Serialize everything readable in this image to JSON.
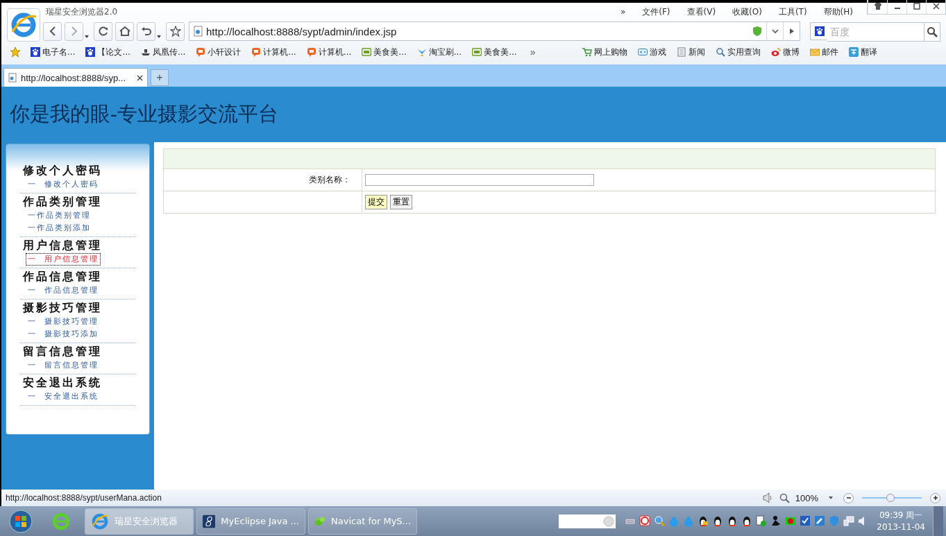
{
  "browser": {
    "title": "瑞星安全浏览器2.0",
    "menu_overflow": "»",
    "menu": [
      "文件(F)",
      "查看(V)",
      "收藏(O)",
      "工具(T)",
      "帮助(H)"
    ],
    "address": "http://localhost:8888/sypt/admin/index.jsp",
    "search": {
      "placeholder": "百度"
    },
    "bookmarks": [
      {
        "label": "电子名...",
        "kind": "paw"
      },
      {
        "label": "【论文...",
        "kind": "paw"
      },
      {
        "label": "凤凰传...",
        "kind": "boat"
      },
      {
        "label": "小轩设计",
        "kind": "tao"
      },
      {
        "label": "计算机...",
        "kind": "tao"
      },
      {
        "label": "计算机...",
        "kind": "tao"
      },
      {
        "label": "美食美...",
        "kind": "iqiyi"
      },
      {
        "label": "淘宝刷...",
        "kind": "bird"
      },
      {
        "label": "美食美...",
        "kind": "iqiyi"
      }
    ],
    "bookmarks_overflow": "»",
    "quick_links": [
      {
        "label": "网上购物",
        "kind": "cart"
      },
      {
        "label": "游戏",
        "kind": "game"
      },
      {
        "label": "新闻",
        "kind": "news"
      },
      {
        "label": "实用查询",
        "kind": "search"
      },
      {
        "label": "微博",
        "kind": "weibo"
      },
      {
        "label": "邮件",
        "kind": "mail"
      },
      {
        "label": "翻译",
        "kind": "translate"
      }
    ],
    "tabs": [
      {
        "title": "http://localhost:8888/syp...",
        "selected": true
      }
    ],
    "new_tab": "+"
  },
  "page": {
    "header": "你是我的眼-专业摄影交流平台",
    "sidebar": [
      {
        "title": "修改个人密码",
        "links": [
          {
            "label": "一  修改个人密码",
            "selected": false
          }
        ]
      },
      {
        "title": "作品类别管理",
        "links": [
          {
            "label": "一作品类别管理",
            "selected": false
          },
          {
            "label": "一作品类别添加",
            "selected": false
          }
        ]
      },
      {
        "title": "用户信息管理",
        "links": [
          {
            "label": "一  用户信息管理",
            "selected": true
          }
        ]
      },
      {
        "title": "作品信息管理",
        "links": [
          {
            "label": "一  作品信息管理",
            "selected": false
          }
        ]
      },
      {
        "title": "摄影技巧管理",
        "links": [
          {
            "label": "一  摄影技巧管理",
            "selected": false
          },
          {
            "label": "一  摄影技巧添加",
            "selected": false
          }
        ]
      },
      {
        "title": "留言信息管理",
        "links": [
          {
            "label": "一  留言信息管理",
            "selected": false
          }
        ]
      },
      {
        "title": "安全退出系统",
        "links": [
          {
            "label": "一  安全退出系统",
            "selected": false
          }
        ]
      }
    ],
    "form": {
      "field_label": "类别名称：",
      "buttons": [
        {
          "label": "提交",
          "kind": "submit"
        },
        {
          "label": "重置",
          "kind": "reset"
        }
      ]
    }
  },
  "status_bar": {
    "url": "http://localhost:8888/sypt/userMana.action",
    "zoom": "100%",
    "zoom_slider": {
      "level": 0.48
    }
  },
  "taskbar": {
    "windows": [
      {
        "label": "瑞星安全浏览器",
        "kind": "ie",
        "selected": true
      },
      {
        "label": "MyEclipse Java ...",
        "kind": "eight",
        "selected": false
      },
      {
        "label": "Navicat for MyS...",
        "kind": "leaf",
        "selected": false
      }
    ],
    "clock": {
      "time": "09:39 周一",
      "date": "2013-11-04"
    }
  }
}
